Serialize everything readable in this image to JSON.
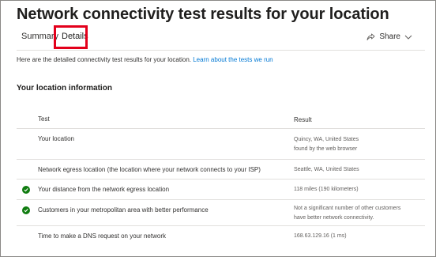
{
  "page": {
    "title": "Network connectivity test results for your location"
  },
  "tabs": [
    {
      "label": "Summary"
    },
    {
      "label": "Details"
    }
  ],
  "share": {
    "label": "Share",
    "icon": "share-icon",
    "chevron_icon": "chevron-down-icon"
  },
  "intro": {
    "text": "Here are the detailed connectivity test results for your location.",
    "link": "Learn about the tests we run"
  },
  "section": {
    "title": "Your location information"
  },
  "table": {
    "columns": [
      "Test",
      "Result"
    ],
    "rows": [
      {
        "test": "Your location",
        "result_line1": "Quincy, WA, United States",
        "result_line2": "found by the web browser",
        "status": "none"
      },
      {
        "test": "Network egress location (the location where your network connects to your ISP)",
        "result_line1": "Seattle, WA, United States",
        "result_line2": "",
        "status": "none"
      },
      {
        "test": "Your distance from the network egress location",
        "result_line1": "118 miles (190 kilometers)",
        "result_line2": "",
        "status": "pass"
      },
      {
        "test": "Customers in your metropolitan area with better performance",
        "result_line1": "Not a significant number of other customers",
        "result_line2": "have better network connectivity.",
        "status": "pass"
      },
      {
        "test": "Time to make a DNS request on your network",
        "result_line1": "168.63.129.16 (1 ms)",
        "result_line2": "",
        "status": "none"
      }
    ]
  },
  "colors": {
    "accent": "#0078d4",
    "highlight": "#e3001b",
    "pass": "#107c10"
  }
}
